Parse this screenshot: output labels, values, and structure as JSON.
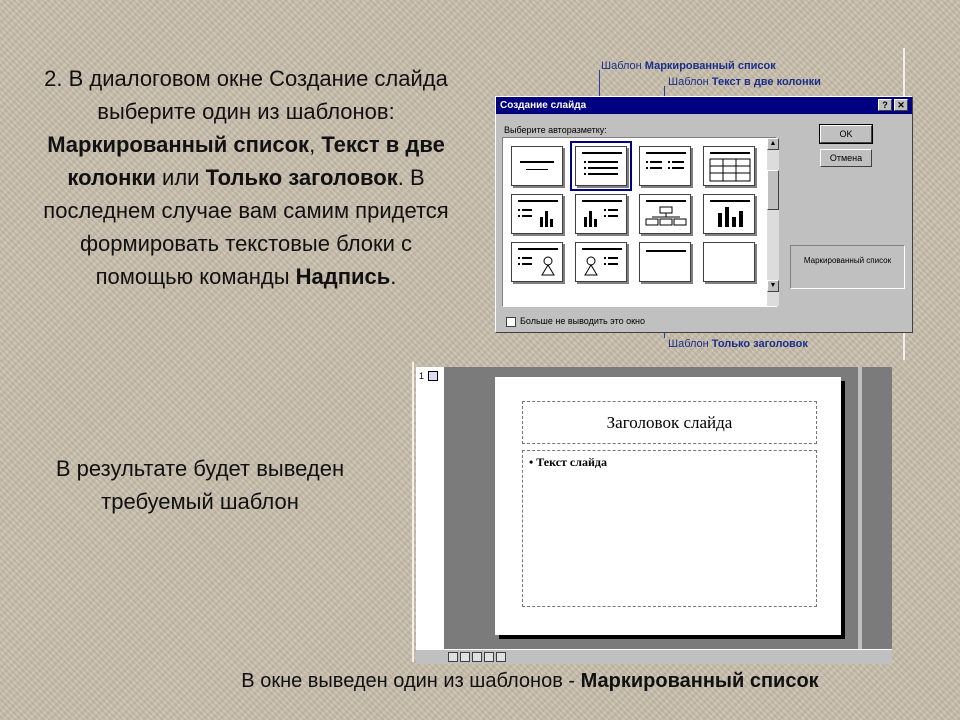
{
  "instruction": {
    "p1": "2. В диалоговом окне Создание слайда выберите один из шаблонов: ",
    "b1": "Маркированный список",
    "p2": ", ",
    "b2": "Текст в две колонки",
    "p3": " или ",
    "b3": "Только заголовок",
    "p4": ". В последнем случае вам самим придется формировать текстовые блоки с помощью команды ",
    "b4": "Надпись",
    "p5": "."
  },
  "callouts": {
    "bulleted_prefix": "Шаблон ",
    "bulleted_name": "Маркированный список",
    "twocol_prefix": "Шаблон ",
    "twocol_name": "Текст в две колонки",
    "titleonly_prefix": "Шаблон ",
    "titleonly_name": "Только заголовок"
  },
  "dialog": {
    "title": "Создание слайда",
    "help_btn": "?",
    "close_btn": "✕",
    "label": "Выберите авторазметку:",
    "ok": "OK",
    "cancel": "Отмена",
    "preview": "Маркированный список",
    "checkbox": "Больше не выводить это окно",
    "scroll_up": "▲",
    "scroll_down": "▼"
  },
  "ppt": {
    "slide_number": "1",
    "title_placeholder": "Заголовок слайда",
    "body_placeholder": "• Текст слайда"
  },
  "result": "В результате будет выведен требуемый шаблон",
  "caption": {
    "prefix": "В окне выведен один из шаблонов - ",
    "bold": "Маркированный список"
  }
}
